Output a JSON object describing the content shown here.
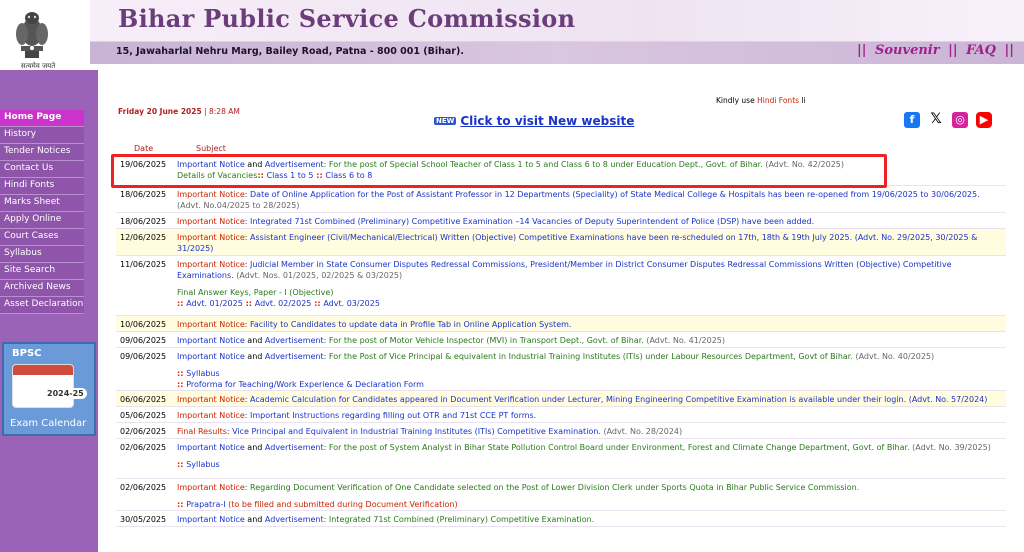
{
  "header": {
    "emblem_text": "सत्यमेव जयते",
    "title": "Bihar Public Service Commission",
    "address": "15, Jawaharlal Nehru Marg, Bailey Road, Patna - 800 001 (Bihar).",
    "links": [
      "Souvenir",
      "FAQ"
    ]
  },
  "nav": {
    "items": [
      "Home Page",
      "History",
      "Tender Notices",
      "Contact Us",
      "Hindi Fonts",
      "Marks Sheet",
      "Apply Online",
      "Court Cases",
      "Syllabus",
      "Site Search",
      "Archived News",
      "Asset Declaration"
    ]
  },
  "exam_calendar": {
    "brand": "BPSC",
    "year": "2024-25",
    "label": "Exam Calendar"
  },
  "topbar": {
    "date": "Friday 20 June 2025",
    "time": "8:28 AM",
    "kindly": "Kindly use",
    "hindi_fonts": "Hindi Fonts",
    "kindly_tail": "li",
    "new_badge": "NEW",
    "new_site": "Click to visit New website"
  },
  "social_icons": [
    "facebook-icon",
    "x-icon",
    "instagram-icon",
    "youtube-icon"
  ],
  "table": {
    "col_date": "Date",
    "col_subject": "Subject",
    "rows": [
      {
        "date": "19/06/2025",
        "lead": "Important Notice",
        "and": " and ",
        "lead2": "Advertisement",
        "text": ": For the post of Special School Teacher of Class 1 to 5 and Class 6 to 8 under Education Dept., Govt. of Bihar.",
        "advt": " (Advt. No. 42/2025)",
        "extra_label": "Details of Vacancies",
        "extra_links": [
          "Class 1 to 5",
          "Class 6 to 8"
        ]
      },
      {
        "date": "18/06/2025",
        "lead": "Important Notice",
        "text": ": Date of Online Application for the Post of Assistant Professor in 12 Departments (Speciality) of State Medical College & Hospitals has been re-opened from 19/06/2025 to 30/06/2025.",
        "advt": " (Advt. No.04/2025 to 28/2025)"
      },
      {
        "date": "18/06/2025",
        "lead": "Important Notice",
        "text": ": Integrated 71st Combined (Preliminary) Competitive Examination –14 Vacancies of Deputy Superintendent of Police (DSP) have been added."
      },
      {
        "date": "12/06/2025",
        "lead": "Important Notice",
        "text": ": Assistant Engineer (Civil/Mechanical/Electrical) Written (Objective) Competitive Examinations have been re-scheduled on 17th, 18th & 19th July 2025. (Advt. No. 29/2025, 30/2025 & 31/2025)"
      },
      {
        "date": "11/06/2025",
        "lead": "Important Notice",
        "text": ": Judicial Member in State Consumer Disputes Redressal Commissions, President/Member in District Consumer Disputes Redressal Commissions Written (Objective) Competitive Examinations.",
        "advt": " (Advt. Nos. 01/2025, 02/2025 & 03/2025)",
        "extra_label": "Final Answer Keys, Paper - I (Objective)",
        "extra_links": [
          "Advt. 01/2025",
          "Advt. 02/2025",
          "Advt. 03/2025"
        ]
      },
      {
        "date": "10/06/2025",
        "lead": "Important Notice",
        "text": ": Facility to Candidates to update data in Profile Tab in Online Application System."
      },
      {
        "date": "09/06/2025",
        "lead": "Important Notice",
        "and": " and ",
        "lead2": "Advertisement",
        "text": ": For the post of Motor Vehicle Inspector (MVI) in Transport Dept., Govt. of Bihar.",
        "advt": " (Advt. No. 41/2025)"
      },
      {
        "date": "09/06/2025",
        "lead": "Important Notice",
        "and": " and ",
        "lead2": "Advertisement",
        "text": ": For the Post of Vice Principal & equivalent in Industrial Training Institutes (ITIs) under Labour Resources Department, Govt of Bihar.",
        "advt": " (Advt. No. 40/2025)",
        "sub_links": [
          "Syllabus",
          "Proforma for Teaching/Work Experience & Declaration Form"
        ]
      },
      {
        "date": "06/06/2025",
        "lead": "Important Notice",
        "text": ": Academic Calculation for Candidates appeared in Document Verification under Lecturer, Mining Engineering Competitive Examination is available under their login. (Advt. No. 57/2024)"
      },
      {
        "date": "05/06/2025",
        "lead": "Important Notice",
        "text": ": Important Instructions regarding filling out OTR and 71st CCE PT forms."
      },
      {
        "date": "02/06/2025",
        "lead": "Final Results",
        "text": ": Vice Principal and Equivalent in Industrial Training Institutes (ITIs) Competitive Examination.",
        "advt": " (Advt. No. 28/2024)"
      },
      {
        "date": "02/06/2025",
        "lead": "Important Notice",
        "and": " and ",
        "lead2": "Advertisement",
        "text": ": For the post of System Analyst in Bihar State Pollution Control Board under Environment, Forest and Climate Change Department, Govt. of Bihar.",
        "advt": " (Advt. No. 39/2025)",
        "sub_links": [
          "Syllabus"
        ]
      },
      {
        "date": "02/06/2025",
        "lead": "Important Notice",
        "text": ": Regarding Document Verification of One Candidate selected on the Post of Lower Division Clerk under Sports Quota in Bihar Public Service Commission.",
        "sub_mixed": {
          "link": "Prapatra-I",
          "tail": " (to be filled and submitted during Document Verification)"
        }
      },
      {
        "date": "30/05/2025",
        "lead": "Important Notice",
        "and": " and ",
        "lead2": "Advertisement",
        "text": ": Integrated 71st Combined (Preliminary) Competitive Examination."
      }
    ]
  }
}
